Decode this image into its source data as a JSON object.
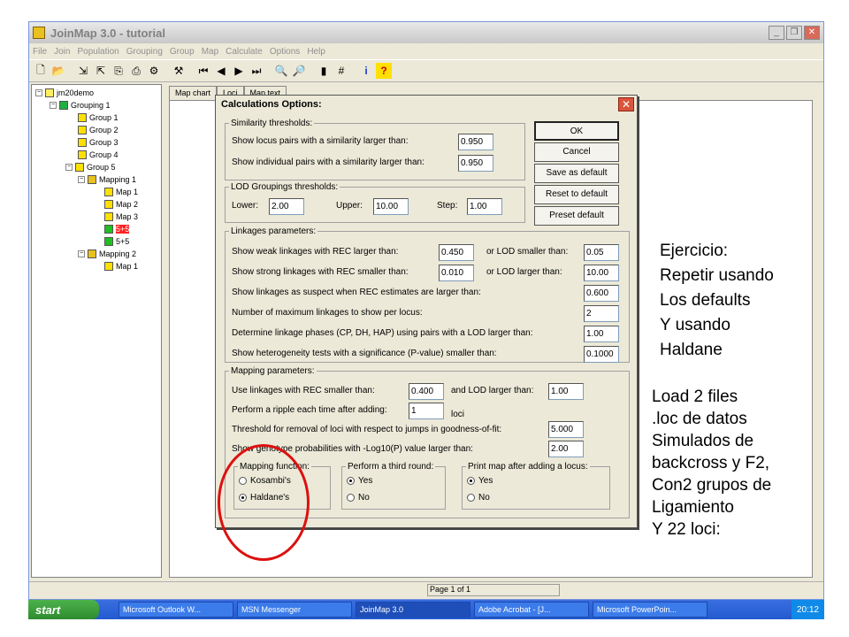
{
  "window": {
    "title": "JoinMap 3.0  -  tutorial",
    "menu": [
      "File",
      "Join",
      "Population",
      "Grouping",
      "Group",
      "Map",
      "Calculate",
      "Options",
      "Help"
    ]
  },
  "tree": {
    "root": "jm20demo",
    "grouping": "Grouping 1",
    "groups": [
      "Group 1",
      "Group 2",
      "Group 3",
      "Group 4",
      "Group 5"
    ],
    "mapping1": "Mapping 1",
    "maps1": [
      "Map 1",
      "Map 2",
      "Map 3",
      "5+5",
      "5+5"
    ],
    "mapping2": "Mapping 2",
    "maps2": [
      "Map 1"
    ]
  },
  "tabs": [
    "Map chart",
    "Loci",
    "Map text"
  ],
  "status": {
    "page": "Page 1 of 1"
  },
  "dialog": {
    "title": "Calculations Options:",
    "similarity": {
      "legend": "Similarity thresholds:",
      "locus_label": "Show locus pairs with a similarity larger than:",
      "locus_value": "0.950",
      "individual_label": "Show individual pairs with a similarity larger than:",
      "individual_value": "0.950"
    },
    "lod": {
      "legend": "LOD Groupings thresholds:",
      "lower_label": "Lower:",
      "lower_value": "2.00",
      "upper_label": "Upper:",
      "upper_value": "10.00",
      "step_label": "Step:",
      "step_value": "1.00"
    },
    "linkages": {
      "legend": "Linkages parameters:",
      "weak_label": "Show weak linkages with REC larger than:",
      "weak_value": "0.450",
      "weak_lod_label": "or LOD smaller than:",
      "weak_lod_value": "0.05",
      "strong_label": "Show strong linkages with REC smaller than:",
      "strong_value": "0.010",
      "strong_lod_label": "or LOD larger than:",
      "strong_lod_value": "10.00",
      "suspect_label": "Show linkages as suspect when REC estimates are larger than:",
      "suspect_value": "0.600",
      "max_label": "Number of maximum linkages to show per locus:",
      "max_value": "2",
      "phase_label": "Determine linkage phases (CP, DH, HAP) using pairs with a LOD larger than:",
      "phase_value": "1.00",
      "hetero_label": "Show heterogeneity tests with a significance (P-value) smaller than:",
      "hetero_value": "0.1000"
    },
    "mapping": {
      "legend": "Mapping parameters:",
      "rec_label": "Use linkages with REC smaller than:",
      "rec_value": "0.400",
      "lod_label": "and LOD larger than:",
      "lod_value": "1.00",
      "ripple_label": "Perform a ripple each time after adding:",
      "ripple_value": "1",
      "ripple_unit": "loci",
      "threshold_label": "Threshold for removal of loci with respect to jumps in goodness-of-fit:",
      "threshold_value": "5.000",
      "genotype_label": "Show genotype probabilities with -Log10(P) value larger than:",
      "genotype_value": "2.00",
      "function_legend": "Mapping function:",
      "kosambi": "Kosambi's",
      "haldane": "Haldane's",
      "third_legend": "Perform a third round:",
      "third_yes": "Yes",
      "third_no": "No",
      "print_legend": "Print map after adding a locus:",
      "print_yes": "Yes",
      "print_no": "No"
    },
    "buttons": {
      "ok": "OK",
      "cancel": "Cancel",
      "save": "Save as default",
      "reset": "Reset to default",
      "preset": "Preset default"
    }
  },
  "notes": {
    "note1": [
      "Ejercicio:",
      "Repetir usando",
      "Los defaults",
      "Y usando",
      "Haldane"
    ],
    "note2": [
      "Load 2 files",
      ".loc de datos",
      "Simulados de",
      "backcross y F2,",
      "Con2 grupos de",
      "Ligamiento",
      "Y 22 loci:"
    ]
  },
  "taskbar": {
    "start": "start",
    "tasks": [
      "Microsoft Outlook W...",
      "MSN Messenger",
      "JoinMap 3.0",
      "Adobe Acrobat - [J...",
      "Microsoft PowerPoin..."
    ],
    "clock": "20:12"
  }
}
